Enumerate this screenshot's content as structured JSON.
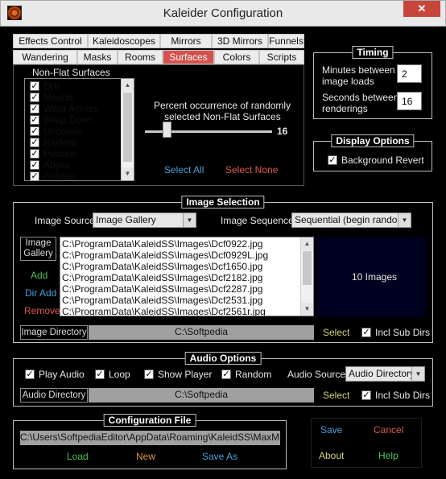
{
  "window": {
    "title": "Kaleider Configuration",
    "close": "✕"
  },
  "tabs_row1": [
    "Effects Control",
    "Kaleidoscopes",
    "Mirrors",
    "3D Mirrors",
    "Funnels"
  ],
  "tabs_row2": [
    "Wandering",
    "Masks",
    "Rooms",
    "Surfaces",
    "Colors",
    "Scripts"
  ],
  "active_tab": "Surfaces",
  "surfaces": {
    "heading": "Non-Flat Surfaces",
    "items": [
      {
        "label": "Orb",
        "checked": true
      },
      {
        "label": "Mound",
        "checked": true
      },
      {
        "label": "Warp Across",
        "checked": true
      },
      {
        "label": "Warp Down",
        "checked": true
      },
      {
        "label": "Undulate",
        "checked": true
      },
      {
        "label": "Radiate",
        "checked": true
      },
      {
        "label": "Pulsate",
        "checked": true
      },
      {
        "label": "Abyss",
        "checked": true
      },
      {
        "label": "Grinder",
        "checked": true
      }
    ],
    "percent_label_line1": "Percent occurrence of randomly",
    "percent_label_line2": "selected Non-Flat Surfaces",
    "slider_value": "16",
    "select_all": "Select All",
    "select_none": "Select None"
  },
  "timing": {
    "title": "Timing",
    "minutes_label_1": "Minutes between",
    "minutes_label_2": "image loads",
    "minutes_value": "2",
    "seconds_label_1": "Seconds between",
    "seconds_label_2": "renderings",
    "seconds_value": "16"
  },
  "display": {
    "title": "Display Options",
    "background_revert": "Background Revert",
    "background_revert_checked": true
  },
  "image_selection": {
    "title": "Image Selection",
    "source_label": "Image Source",
    "source_value": "Image Gallery",
    "sequence_label": "Image Sequence",
    "sequence_value": "Sequential (begin random)",
    "gallery_btn_1": "Image",
    "gallery_btn_2": "Gallery",
    "add": "Add",
    "dir_add": "Dir Add",
    "remove": "Remove",
    "files": [
      "C:\\ProgramData\\KaleidSS\\Images\\Dcf0922.jpg",
      "C:\\ProgramData\\KaleidSS\\Images\\Dcf0929L.jpg",
      "C:\\ProgramData\\KaleidSS\\Images\\Dcf1650.jpg",
      "C:\\ProgramData\\KaleidSS\\Images\\Dcf2182.jpg",
      "C:\\ProgramData\\KaleidSS\\Images\\Dcf2287.jpg",
      "C:\\ProgramData\\KaleidSS\\Images\\Dcf2531.jpg",
      "C:\\ProgramData\\KaleidSS\\Images\\Dcf2561r.jpg"
    ],
    "count_text": "10 Images",
    "directory_btn": "Image Directory",
    "directory_value": "C:\\Softpedia",
    "select": "Select",
    "incl_sub_dirs": "Incl Sub Dirs",
    "incl_sub_dirs_checked": true
  },
  "audio": {
    "title": "Audio Options",
    "play_audio": "Play Audio",
    "loop": "Loop",
    "show_player": "Show Player",
    "random": "Random",
    "play_audio_checked": true,
    "loop_checked": true,
    "show_player_checked": true,
    "random_checked": true,
    "source_label": "Audio Source",
    "source_value": "Audio Directory",
    "directory_btn": "Audio Directory",
    "directory_value": "C:\\Softpedia",
    "select": "Select",
    "incl_sub_dirs": "Incl Sub Dirs",
    "incl_sub_dirs_checked": true
  },
  "config_file": {
    "title": "Configuration File",
    "path": "C:\\Users\\SoftpediaEditor\\AppData\\Roaming\\KaleidSS\\MaxMix.kfg",
    "load": "Load",
    "new": "New",
    "save_as": "Save As"
  },
  "actions": {
    "save": "Save",
    "cancel": "Cancel",
    "about": "About",
    "help": "Help"
  },
  "colors": {
    "link_blue": "#4b9fd6",
    "link_red": "#e0584f",
    "link_green": "#4cc257",
    "link_orange": "#e39633",
    "link_yellow": "#d6d07a",
    "active_tab": "#d4524e",
    "image_preview": "#000020"
  }
}
